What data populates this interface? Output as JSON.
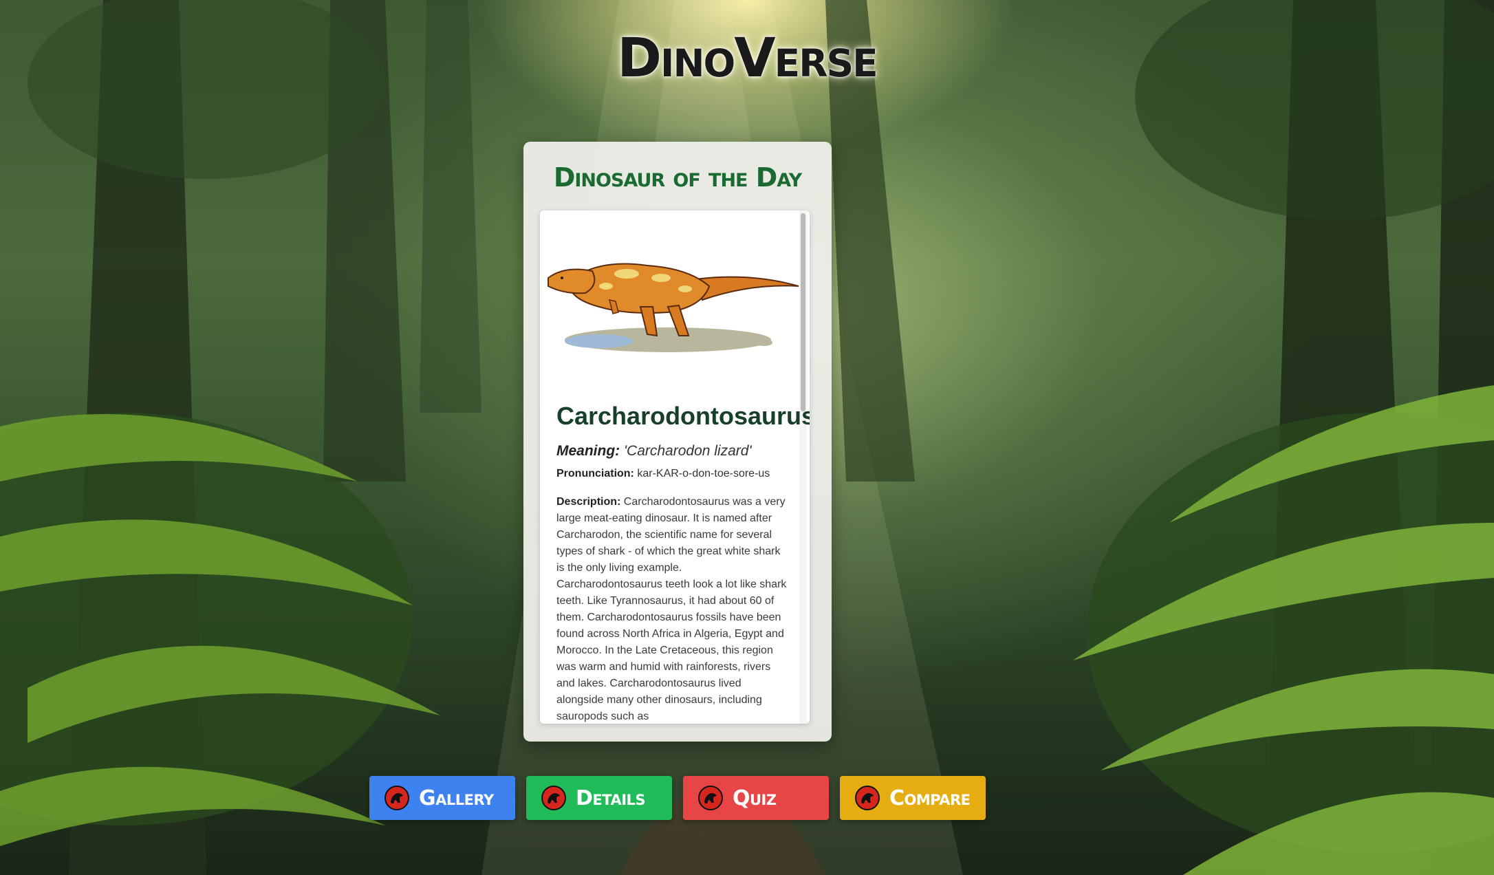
{
  "app": {
    "title": "DinoVerse"
  },
  "card": {
    "heading": "Dinosaur of the Day",
    "dinosaur": {
      "name": "Carcharodontosaurus",
      "meaning_label": "Meaning:",
      "meaning": "'Carcharodon lizard'",
      "pronunciation_label": "Pronunciation:",
      "pronunciation": "kar-KAR-o-don-toe-sore-us",
      "description_label": "Description:",
      "description": "Carcharodontosaurus was a very large meat-eating dinosaur. It is named after Carcharodon, the scientific name for several types of shark - of which the great white shark is the only living example. Carcharodontosaurus teeth look a lot like shark teeth. Like Tyrannosaurus, it had about 60 of them. Carcharodontosaurus fossils have been found across North Africa in Algeria, Egypt and Morocco. In the Late Cretaceous, this region was warm and humid with rainforests, rivers and lakes. Carcharodontosaurus lived alongside many other dinosaurs, including sauropods such as"
    }
  },
  "nav": {
    "buttons": [
      {
        "label": "Gallery",
        "icon": "dinosaur-logo-icon",
        "color": "#3d82ef"
      },
      {
        "label": "Details",
        "icon": "dinosaur-logo-icon",
        "color": "#22bb5a"
      },
      {
        "label": "Quiz",
        "icon": "dinosaur-logo-icon",
        "color": "#e84646"
      },
      {
        "label": "Compare",
        "icon": "dinosaur-logo-icon",
        "color": "#e6ad12"
      }
    ]
  }
}
